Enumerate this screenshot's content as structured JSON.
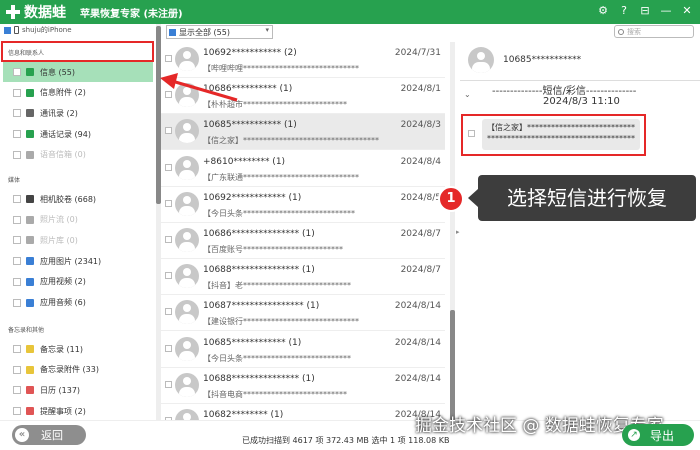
{
  "app": {
    "logo_text": "数据蛙",
    "title": "苹果恢复专家 (未注册)",
    "brand_color": "#27a14f",
    "window_buttons": [
      "⚙",
      "?",
      "⊟",
      "—",
      "✕"
    ]
  },
  "sidebar": {
    "device": "shuju的iPhone",
    "sections": [
      {
        "label": "信息和联系人",
        "items": [
          {
            "label": "信息 (55)",
            "icon": "message-icon",
            "color": "#27a14f",
            "active": true,
            "disabled": false
          },
          {
            "label": "信息附件 (2)",
            "icon": "message-attachment-icon",
            "color": "#27a14f",
            "active": false,
            "disabled": false
          },
          {
            "label": "通讯录 (2)",
            "icon": "contacts-icon",
            "color": "#666666",
            "active": false,
            "disabled": false
          },
          {
            "label": "通话记录 (94)",
            "icon": "phone-icon",
            "color": "#27a14f",
            "active": false,
            "disabled": false
          },
          {
            "label": "语音信箱 (0)",
            "icon": "voicemail-icon",
            "color": "#aaaaaa",
            "active": false,
            "disabled": true
          }
        ]
      },
      {
        "label": "媒体",
        "items": [
          {
            "label": "相机胶卷 (668)",
            "icon": "camera-icon",
            "color": "#444444",
            "active": false,
            "disabled": false
          },
          {
            "label": "照片流 (0)",
            "icon": "photo-stream-icon",
            "color": "#aaaaaa",
            "active": false,
            "disabled": true
          },
          {
            "label": "照片库 (0)",
            "icon": "photo-library-icon",
            "color": "#aaaaaa",
            "active": false,
            "disabled": true
          },
          {
            "label": "应用图片 (2341)",
            "icon": "app-photo-icon",
            "color": "#3a7fd5",
            "active": false,
            "disabled": false
          },
          {
            "label": "应用视频 (2)",
            "icon": "app-video-icon",
            "color": "#3a7fd5",
            "active": false,
            "disabled": false
          },
          {
            "label": "应用音频 (6)",
            "icon": "app-audio-icon",
            "color": "#3a7fd5",
            "active": false,
            "disabled": false
          }
        ]
      },
      {
        "label": "备忘录和其他",
        "items": [
          {
            "label": "备忘录 (11)",
            "icon": "notes-icon",
            "color": "#e8c53a",
            "active": false,
            "disabled": false
          },
          {
            "label": "备忘录附件 (33)",
            "icon": "notes-attachment-icon",
            "color": "#e8c53a",
            "active": false,
            "disabled": false
          },
          {
            "label": "日历 (137)",
            "icon": "calendar-icon",
            "color": "#e05555",
            "active": false,
            "disabled": false
          },
          {
            "label": "提醒事项 (2)",
            "icon": "reminder-icon",
            "color": "#e05555",
            "active": false,
            "disabled": false
          }
        ]
      }
    ],
    "back_label": "返回"
  },
  "filter": {
    "value": "显示全部 (55)"
  },
  "messages": [
    {
      "number": "10692*********** (2)",
      "date": "2024/7/31",
      "preview": "【哔哩哔哩*****************************"
    },
    {
      "number": "10686********** (1)",
      "date": "2024/8/1",
      "preview": "【朴朴超市**************************"
    },
    {
      "number": "10685*********** (1)",
      "date": "2024/8/3",
      "preview": "【信之家】**********************************",
      "selected": true
    },
    {
      "number": "+8610******** (1)",
      "date": "2024/8/4",
      "preview": "【广东联通*****************************"
    },
    {
      "number": "10692************ (1)",
      "date": "2024/8/5",
      "preview": "【今日头条****************************"
    },
    {
      "number": "10686*************** (1)",
      "date": "2024/8/7",
      "preview": "【百度账号*************************"
    },
    {
      "number": "10688*************** (1)",
      "date": "2024/8/7",
      "preview": "【抖音】老***************************"
    },
    {
      "number": "10687**************** (1)",
      "date": "2024/8/14",
      "preview": "【建设银行*****************************"
    },
    {
      "number": "10685************ (1)",
      "date": "2024/8/14",
      "preview": "【今日头条***************************"
    },
    {
      "number": "10688*************** (1)",
      "date": "2024/8/14",
      "preview": "【抖音电商**************************"
    },
    {
      "number": "10682******** (1)",
      "date": "2024/8/14",
      "preview": ""
    }
  ],
  "detail": {
    "search_placeholder": "搜索",
    "number": "10685***********",
    "type_label": "--------------短信/彩信--------------",
    "time": "2024/8/3 11:10",
    "bubble_text": "【信之家】****************************************************************"
  },
  "tooltip": {
    "step": "1",
    "text": "选择短信进行恢复",
    "accent": "#e52828"
  },
  "status": {
    "text": "已成功扫描到 4617 项 372.43 MB   选中 1 项 118.08 KB"
  },
  "export_label": "导出",
  "watermark": "掘金技术社区 @ 数据蛙恢复专家"
}
